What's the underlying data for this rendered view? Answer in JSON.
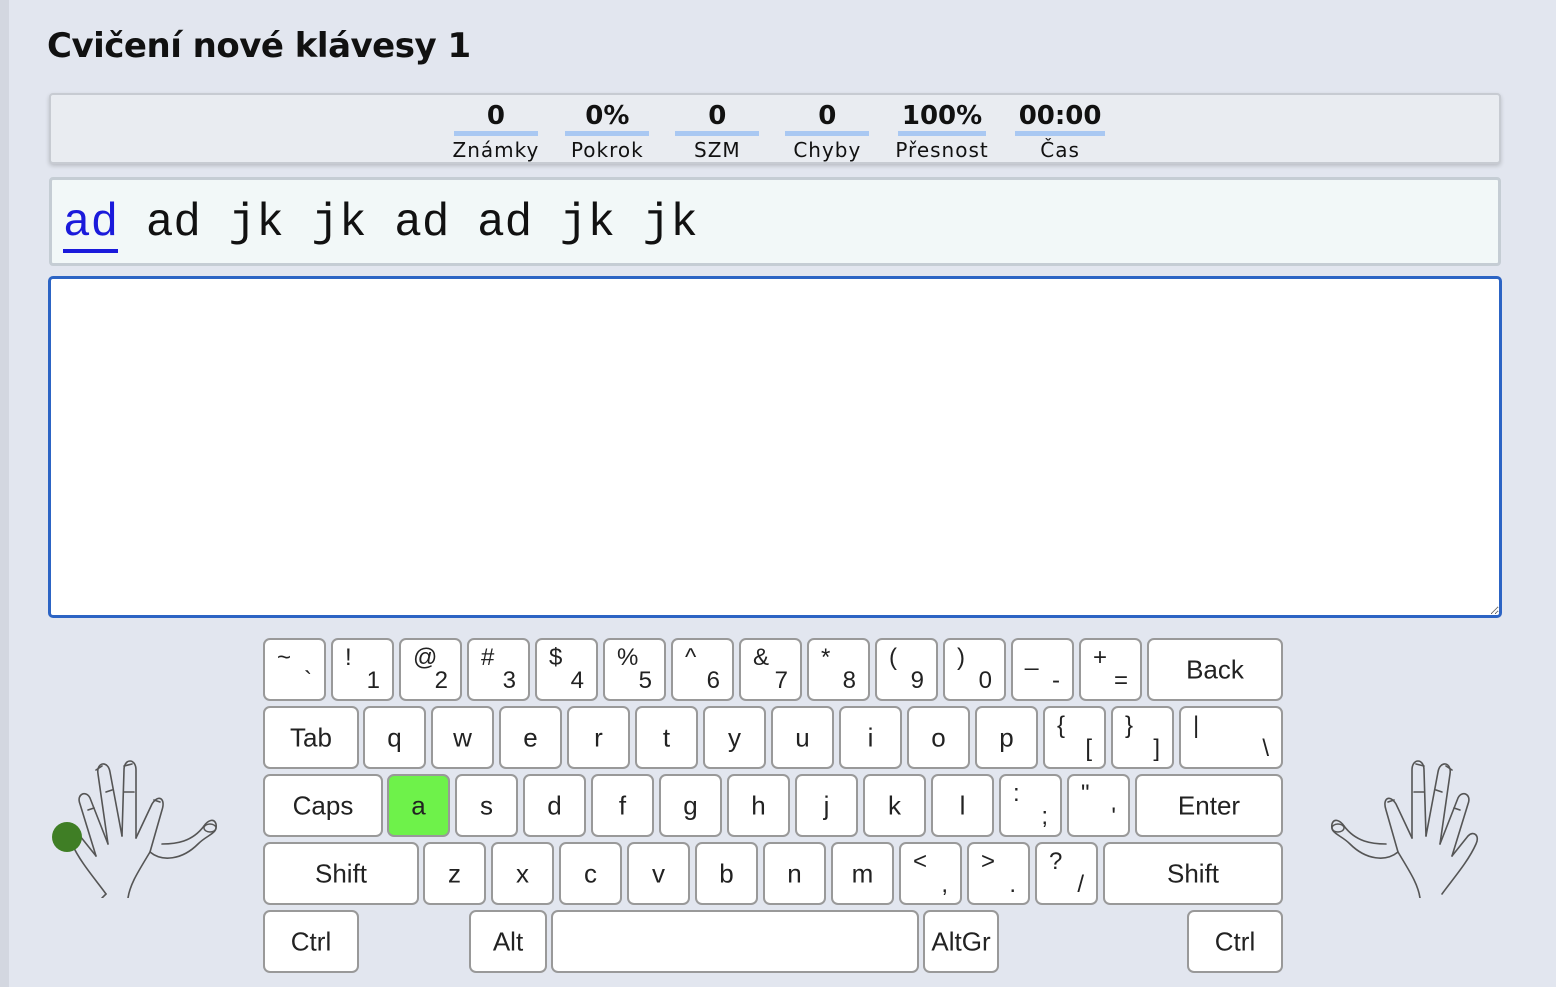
{
  "page": {
    "title": "Cvičení nové klávesy 1"
  },
  "stats": [
    {
      "value": "0",
      "label": "Známky"
    },
    {
      "value": "0%",
      "label": "Pokrok"
    },
    {
      "value": "0",
      "label": "SZM"
    },
    {
      "value": "0",
      "label": "Chyby"
    },
    {
      "value": "100%",
      "label": "Přesnost"
    },
    {
      "value": "00:00",
      "label": "Čas"
    }
  ],
  "prompt": {
    "current_word": "ad",
    "remaining": " ad jk jk ad ad jk jk"
  },
  "typing_area": {
    "value": ""
  },
  "keyboard": {
    "highlight_key": "a",
    "rows": [
      [
        {
          "top": "~",
          "bot": "`"
        },
        {
          "top": "!",
          "bot": "1"
        },
        {
          "top": "@",
          "bot": "2"
        },
        {
          "top": "#",
          "bot": "3"
        },
        {
          "top": "$",
          "bot": "4"
        },
        {
          "top": "%",
          "bot": "5"
        },
        {
          "top": "^",
          "bot": "6"
        },
        {
          "top": "&",
          "bot": "7"
        },
        {
          "top": "*",
          "bot": "8"
        },
        {
          "top": "(",
          "bot": "9"
        },
        {
          "top": ")",
          "bot": "0"
        },
        {
          "top": "_",
          "bot": "-"
        },
        {
          "top": "+",
          "bot": "="
        },
        {
          "main": "Back"
        }
      ],
      [
        {
          "main": "Tab"
        },
        {
          "main": "q"
        },
        {
          "main": "w"
        },
        {
          "main": "e"
        },
        {
          "main": "r"
        },
        {
          "main": "t"
        },
        {
          "main": "y"
        },
        {
          "main": "u"
        },
        {
          "main": "i"
        },
        {
          "main": "o"
        },
        {
          "main": "p"
        },
        {
          "top": "{",
          "bot": "["
        },
        {
          "top": "}",
          "bot": "]"
        },
        {
          "top": "|",
          "bot": "\\"
        }
      ],
      [
        {
          "main": "Caps"
        },
        {
          "main": "a"
        },
        {
          "main": "s"
        },
        {
          "main": "d"
        },
        {
          "main": "f"
        },
        {
          "main": "g"
        },
        {
          "main": "h"
        },
        {
          "main": "j"
        },
        {
          "main": "k"
        },
        {
          "main": "l"
        },
        {
          "top": ":",
          "bot": ";"
        },
        {
          "top": "\"",
          "bot": "'"
        },
        {
          "main": "Enter"
        }
      ],
      [
        {
          "main": "Shift"
        },
        {
          "main": "z"
        },
        {
          "main": "x"
        },
        {
          "main": "c"
        },
        {
          "main": "v"
        },
        {
          "main": "b"
        },
        {
          "main": "n"
        },
        {
          "main": "m"
        },
        {
          "top": "<",
          "bot": ","
        },
        {
          "top": ">",
          "bot": "."
        },
        {
          "top": "?",
          "bot": "/"
        },
        {
          "main": "Shift"
        }
      ],
      [
        {
          "main": "Ctrl"
        },
        {
          "main": "Alt"
        },
        {
          "main": ""
        },
        {
          "main": "AltGr"
        },
        {
          "main": "Ctrl"
        }
      ]
    ]
  },
  "colors": {
    "highlight": "#6ef24a",
    "current_word": "#1a1adb",
    "finger_dot": "#3f7e25",
    "focus_border": "#2c64c4"
  },
  "icons": {
    "left_hand": "left-hand-icon",
    "right_hand": "right-hand-icon"
  }
}
